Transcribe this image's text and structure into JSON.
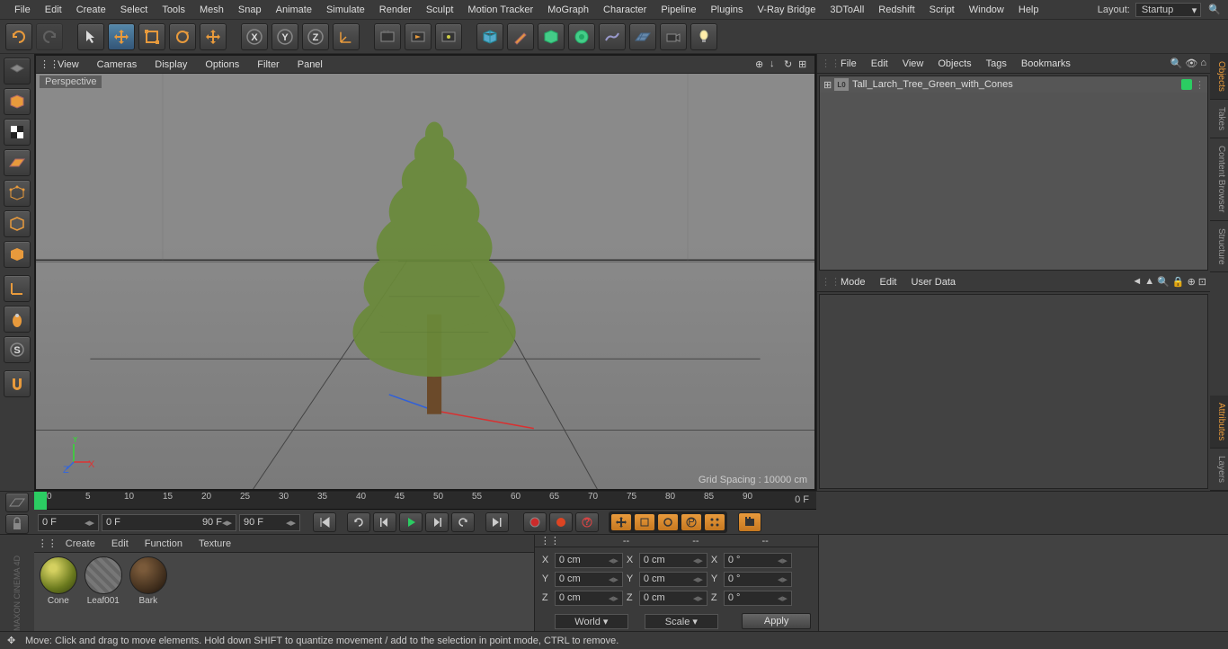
{
  "menubar": [
    "File",
    "Edit",
    "Create",
    "Select",
    "Tools",
    "Mesh",
    "Snap",
    "Animate",
    "Simulate",
    "Render",
    "Sculpt",
    "Motion Tracker",
    "MoGraph",
    "Character",
    "Pipeline",
    "Plugins",
    "V-Ray Bridge",
    "3DToAll",
    "Redshift",
    "Script",
    "Window",
    "Help"
  ],
  "layout": {
    "label": "Layout:",
    "value": "Startup"
  },
  "viewport": {
    "menus": [
      "View",
      "Cameras",
      "Display",
      "Options",
      "Filter",
      "Panel"
    ],
    "label": "Perspective",
    "grid_spacing": "Grid Spacing : 10000 cm"
  },
  "objects_panel": {
    "menus": [
      "File",
      "Edit",
      "View",
      "Objects",
      "Tags",
      "Bookmarks"
    ],
    "item": {
      "name": "Tall_Larch_Tree_Green_with_Cones"
    }
  },
  "attributes_panel": {
    "menus": [
      "Mode",
      "Edit",
      "User Data"
    ]
  },
  "side_tabs_top": [
    "Objects",
    "Takes",
    "Content Browser",
    "Structure"
  ],
  "side_tabs_bottom": [
    "Attributes",
    "Layers"
  ],
  "timeline": {
    "ticks": [
      "0",
      "5",
      "10",
      "15",
      "20",
      "25",
      "30",
      "35",
      "40",
      "45",
      "50",
      "55",
      "60",
      "65",
      "70",
      "75",
      "80",
      "85",
      "90"
    ],
    "end_label": "0 F",
    "start_field": "0 F",
    "from_field": "0 F",
    "to_field": "90 F",
    "cur_field": "90 F"
  },
  "materials": {
    "menus": [
      "Create",
      "Edit",
      "Function",
      "Texture"
    ],
    "items": [
      {
        "name": "Cone",
        "bg": "radial-gradient(circle at 35% 30%, #d4d060 10%, #6b7a1e 60%, #2e3a0e)"
      },
      {
        "name": "Leaf001",
        "bg": "repeating-linear-gradient(45deg,#666 0 4px,#777 4px 8px)"
      },
      {
        "name": "Bark",
        "bg": "radial-gradient(circle at 35% 30%, #7a5a3a 10%, #3b2a1a 70%, #1a1008)"
      }
    ]
  },
  "coords": {
    "header": [
      "--",
      "--",
      "--"
    ],
    "rows": [
      {
        "axis": "X",
        "pos": "0 cm",
        "size": "0 cm",
        "rot": "0 °"
      },
      {
        "axis": "Y",
        "pos": "0 cm",
        "size": "0 cm",
        "rot": "0 °"
      },
      {
        "axis": "Z",
        "pos": "0 cm",
        "size": "0 cm",
        "rot": "0 °"
      }
    ],
    "mode_space": "World",
    "mode_xform": "Scale",
    "apply": "Apply"
  },
  "status": "Move: Click and drag to move elements. Hold down SHIFT to quantize movement / add to the selection in point mode, CTRL to remove."
}
